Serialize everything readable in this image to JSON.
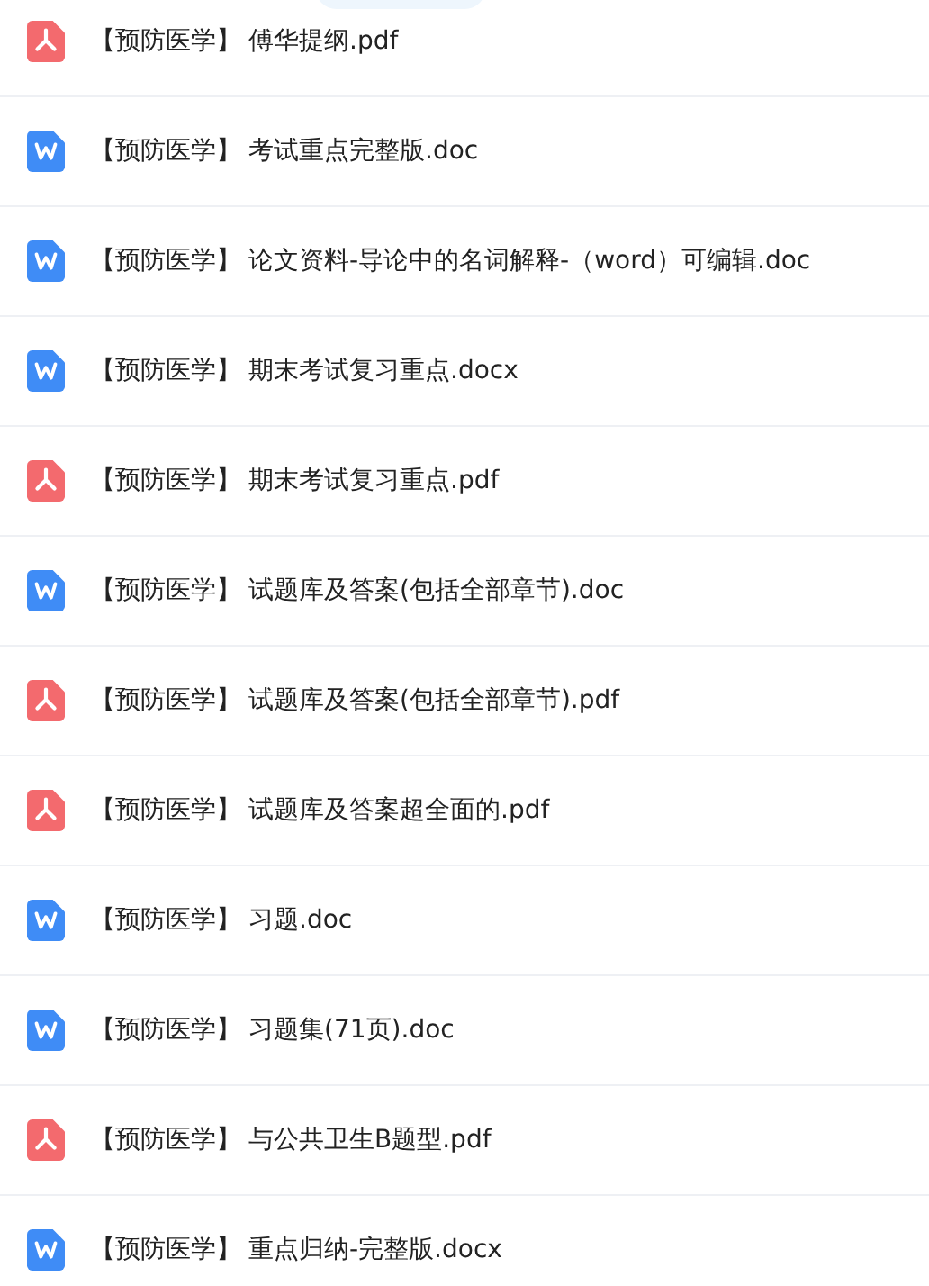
{
  "files": [
    {
      "kind": "pdf",
      "category": "【预防医学】",
      "name": "傅华提纲.pdf"
    },
    {
      "kind": "word",
      "category": "【预防医学】",
      "name": "考试重点完整版.doc"
    },
    {
      "kind": "word",
      "category": "【预防医学】",
      "name": "论文资料-导论中的名词解释-（word）可编辑.doc"
    },
    {
      "kind": "word",
      "category": "【预防医学】",
      "name": "期末考试复习重点.docx"
    },
    {
      "kind": "pdf",
      "category": "【预防医学】",
      "name": "期末考试复习重点.pdf"
    },
    {
      "kind": "word",
      "category": "【预防医学】",
      "name": "试题库及答案(包括全部章节).doc"
    },
    {
      "kind": "pdf",
      "category": "【预防医学】",
      "name": "试题库及答案(包括全部章节).pdf"
    },
    {
      "kind": "pdf",
      "category": "【预防医学】",
      "name": "试题库及答案超全面的.pdf"
    },
    {
      "kind": "word",
      "category": "【预防医学】",
      "name": "习题.doc"
    },
    {
      "kind": "word",
      "category": "【预防医学】",
      "name": "习题集(71页).doc"
    },
    {
      "kind": "pdf",
      "category": "【预防医学】",
      "name": "与公共卫生B题型.pdf"
    },
    {
      "kind": "word",
      "category": "【预防医学】",
      "name": "重点归纳-完整版.docx"
    }
  ]
}
